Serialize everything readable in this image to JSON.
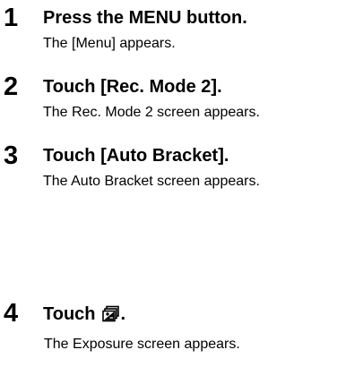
{
  "steps": [
    {
      "number": "1",
      "title": "Press the MENU button.",
      "description": "The [Menu] appears."
    },
    {
      "number": "2",
      "title": "Touch [Rec. Mode 2].",
      "description": "The Rec. Mode 2 screen appears."
    },
    {
      "number": "3",
      "title": "Touch [Auto Bracket].",
      "description": "The Auto Bracket screen appears."
    },
    {
      "number": "4",
      "title": "Touch",
      "title_suffix": ".",
      "icon": "exposure-bracket-icon",
      "description": "The Exposure screen appears."
    }
  ]
}
